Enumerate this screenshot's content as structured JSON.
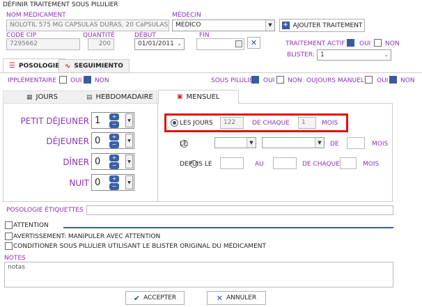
{
  "window_title": "DÉFINIR TRAITEMENT SOUS PILULIER",
  "header": {
    "nom_label": "NOM MÉDICAMENT",
    "nom_value": "NOLOTIL 575 MG CAPSULAS DURAS, 20 CáPSULAS",
    "medecin_label": "MÉDECIN",
    "medecin_value": "MEDICO",
    "ajouter_label": "AJOUTER TRAITEMENT",
    "code_label": "CODE CIP",
    "code_value": "7295662",
    "quantite_label": "QUANTITÉ",
    "quantite_value": "200",
    "debut_label": "DÉBUT",
    "debut_value": "01/01/2011",
    "fin_label": "FIN",
    "fin_value": "",
    "traitement_actif_label": "TRAITEMENT ACTIF",
    "oui": "OUI",
    "non": "NON",
    "blister_label": "BLISTER:",
    "blister_value": "1"
  },
  "tabs": {
    "posologie": "POSOLOGIE",
    "seguimiento": "SEGUIMIENTO"
  },
  "options_row": {
    "supplementaire": "IPPLÉMENTAIRE",
    "oui": "OUI",
    "non": "NON",
    "sous_pilulier": "SOUS PILULIER",
    "manuel": "OUJOURS MANUEL"
  },
  "subtabs": {
    "jours": "JOURS",
    "hebdo": "HEBDOMADAIRE",
    "mensuel": "MENSUEL"
  },
  "doses": [
    {
      "label": "PETIT DÉJEUNER",
      "value": "1"
    },
    {
      "label": "DÉJEUNER",
      "value": "0"
    },
    {
      "label": "DÎNER",
      "value": "0"
    },
    {
      "label": "NUIT",
      "value": "0"
    }
  ],
  "mensuel": {
    "les_jours_label": "LES JOURS",
    "les_jours_value": "122",
    "de_chaque_label": "DE CHAQUE",
    "de_chaque_value": "1",
    "mois_label": "MOIS",
    "le_label": "LE",
    "de_label": "DE",
    "mois2_label": "MOIS",
    "depuis_label": "DEPUIS LE",
    "au_label": "AU",
    "de_chaque2_label": "DE CHAQUE",
    "mois3_label": "MOIS"
  },
  "posologie_etiquettes_label": "POSOLOGIE ÉTIQUETTES",
  "attention_label": "ATTENTION",
  "avertissement_label": "AVERTISSEMENT: MANIPULER AVEC ATTENTION",
  "conditionner_label": "CONDITIONER SOUS PILULIER UTILISANT LE BLISTER ORIGINAL DU MÉDICAMENT",
  "notes_label": "NOTES",
  "notes_value": "notas",
  "footer": {
    "accepter": "ACCEPTER",
    "annuler": "ANNULER"
  },
  "colors": {
    "accent": "#8a33b3",
    "highlight_border": "#e01010",
    "checkbox_on": "#3a5c9c"
  }
}
